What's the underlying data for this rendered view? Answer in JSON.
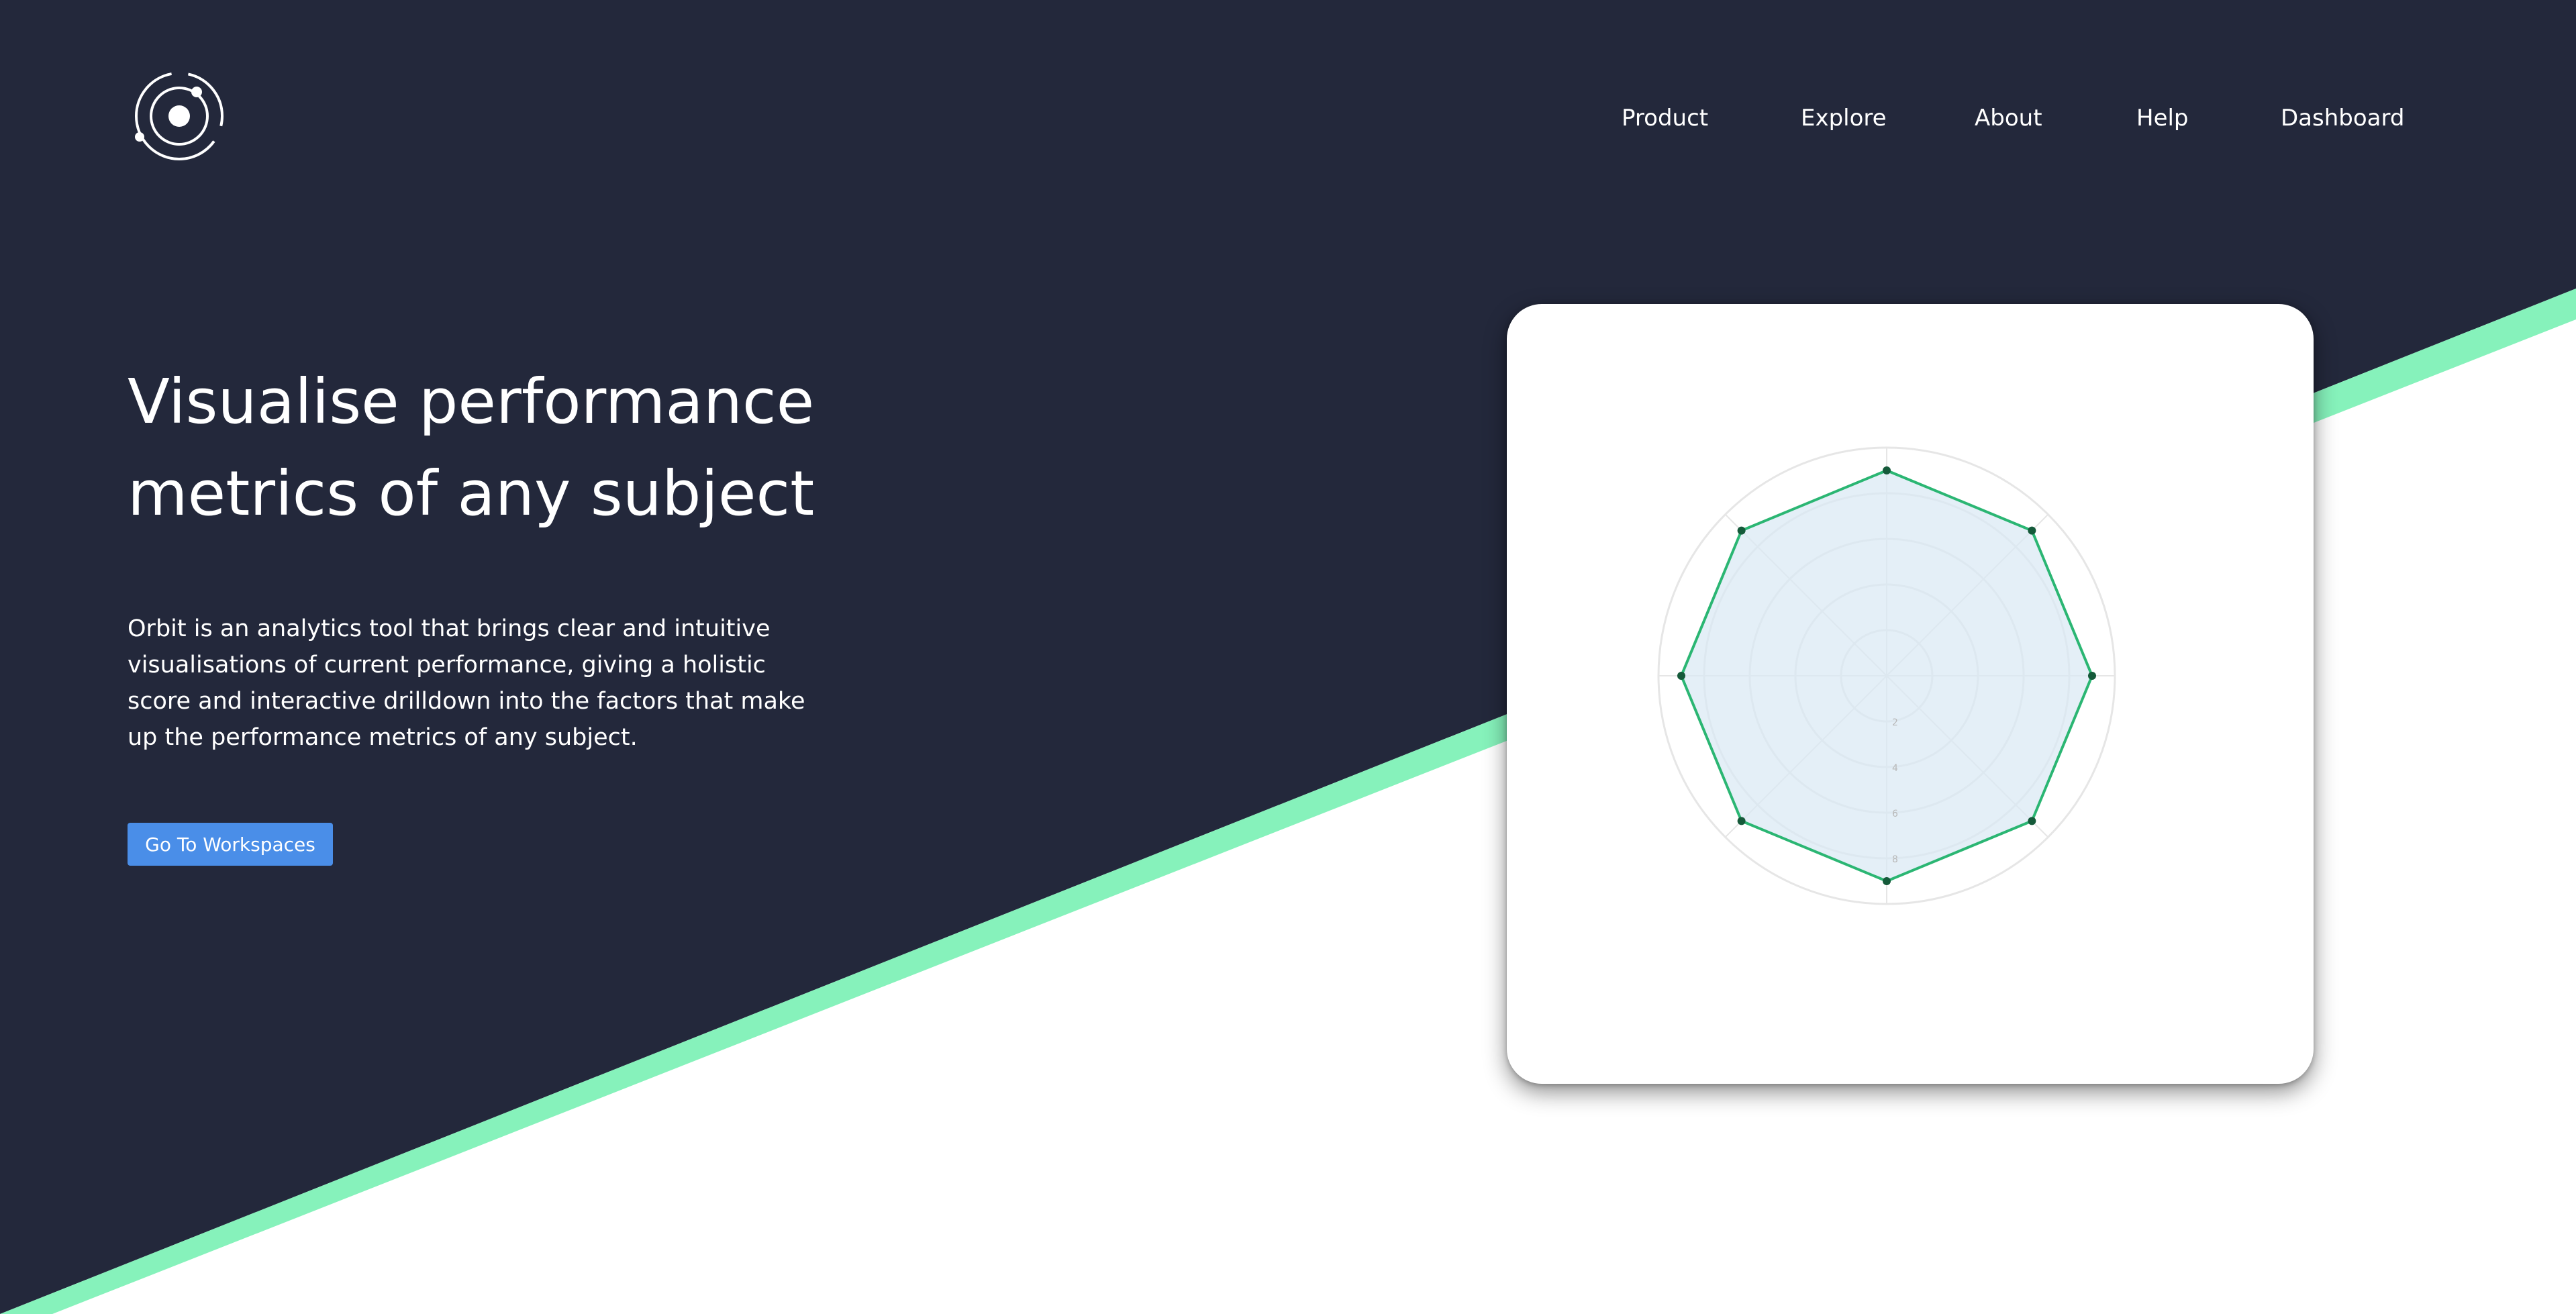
{
  "colors": {
    "dark_navy": "#23283b",
    "accent_green": "#86f2bb",
    "cta_blue": "#4a8ee8",
    "radar_fill": "#d8e8f3",
    "radar_line": "#2bb673",
    "radar_point": "#155a3a",
    "grid": "#e6e6e6"
  },
  "logo": {
    "icon": "orbit-logo-icon"
  },
  "nav": {
    "items": [
      {
        "label": "Product"
      },
      {
        "label": "Explore"
      },
      {
        "label": "About"
      },
      {
        "label": "Help"
      },
      {
        "label": "Dashboard"
      }
    ]
  },
  "hero": {
    "title_line1": "Visualise performance",
    "title_line2": "metrics of any subject",
    "description": "Orbit is an analytics tool that brings clear and intuitive visualisations of current performance, giving a holistic score and interactive drilldown into the factors that make up the performance metrics of any subject.",
    "cta_label": "Go To Workspaces"
  },
  "chart_data": {
    "type": "radar",
    "axes_count": 8,
    "rlim": [
      0,
      10
    ],
    "grid_rings": [
      2,
      4,
      6,
      8,
      10
    ],
    "tick_labels": [
      "2",
      "4",
      "6",
      "8"
    ],
    "series": [
      {
        "values": [
          9,
          9,
          9,
          9,
          9,
          9,
          9,
          9
        ]
      }
    ],
    "grid": true
  }
}
